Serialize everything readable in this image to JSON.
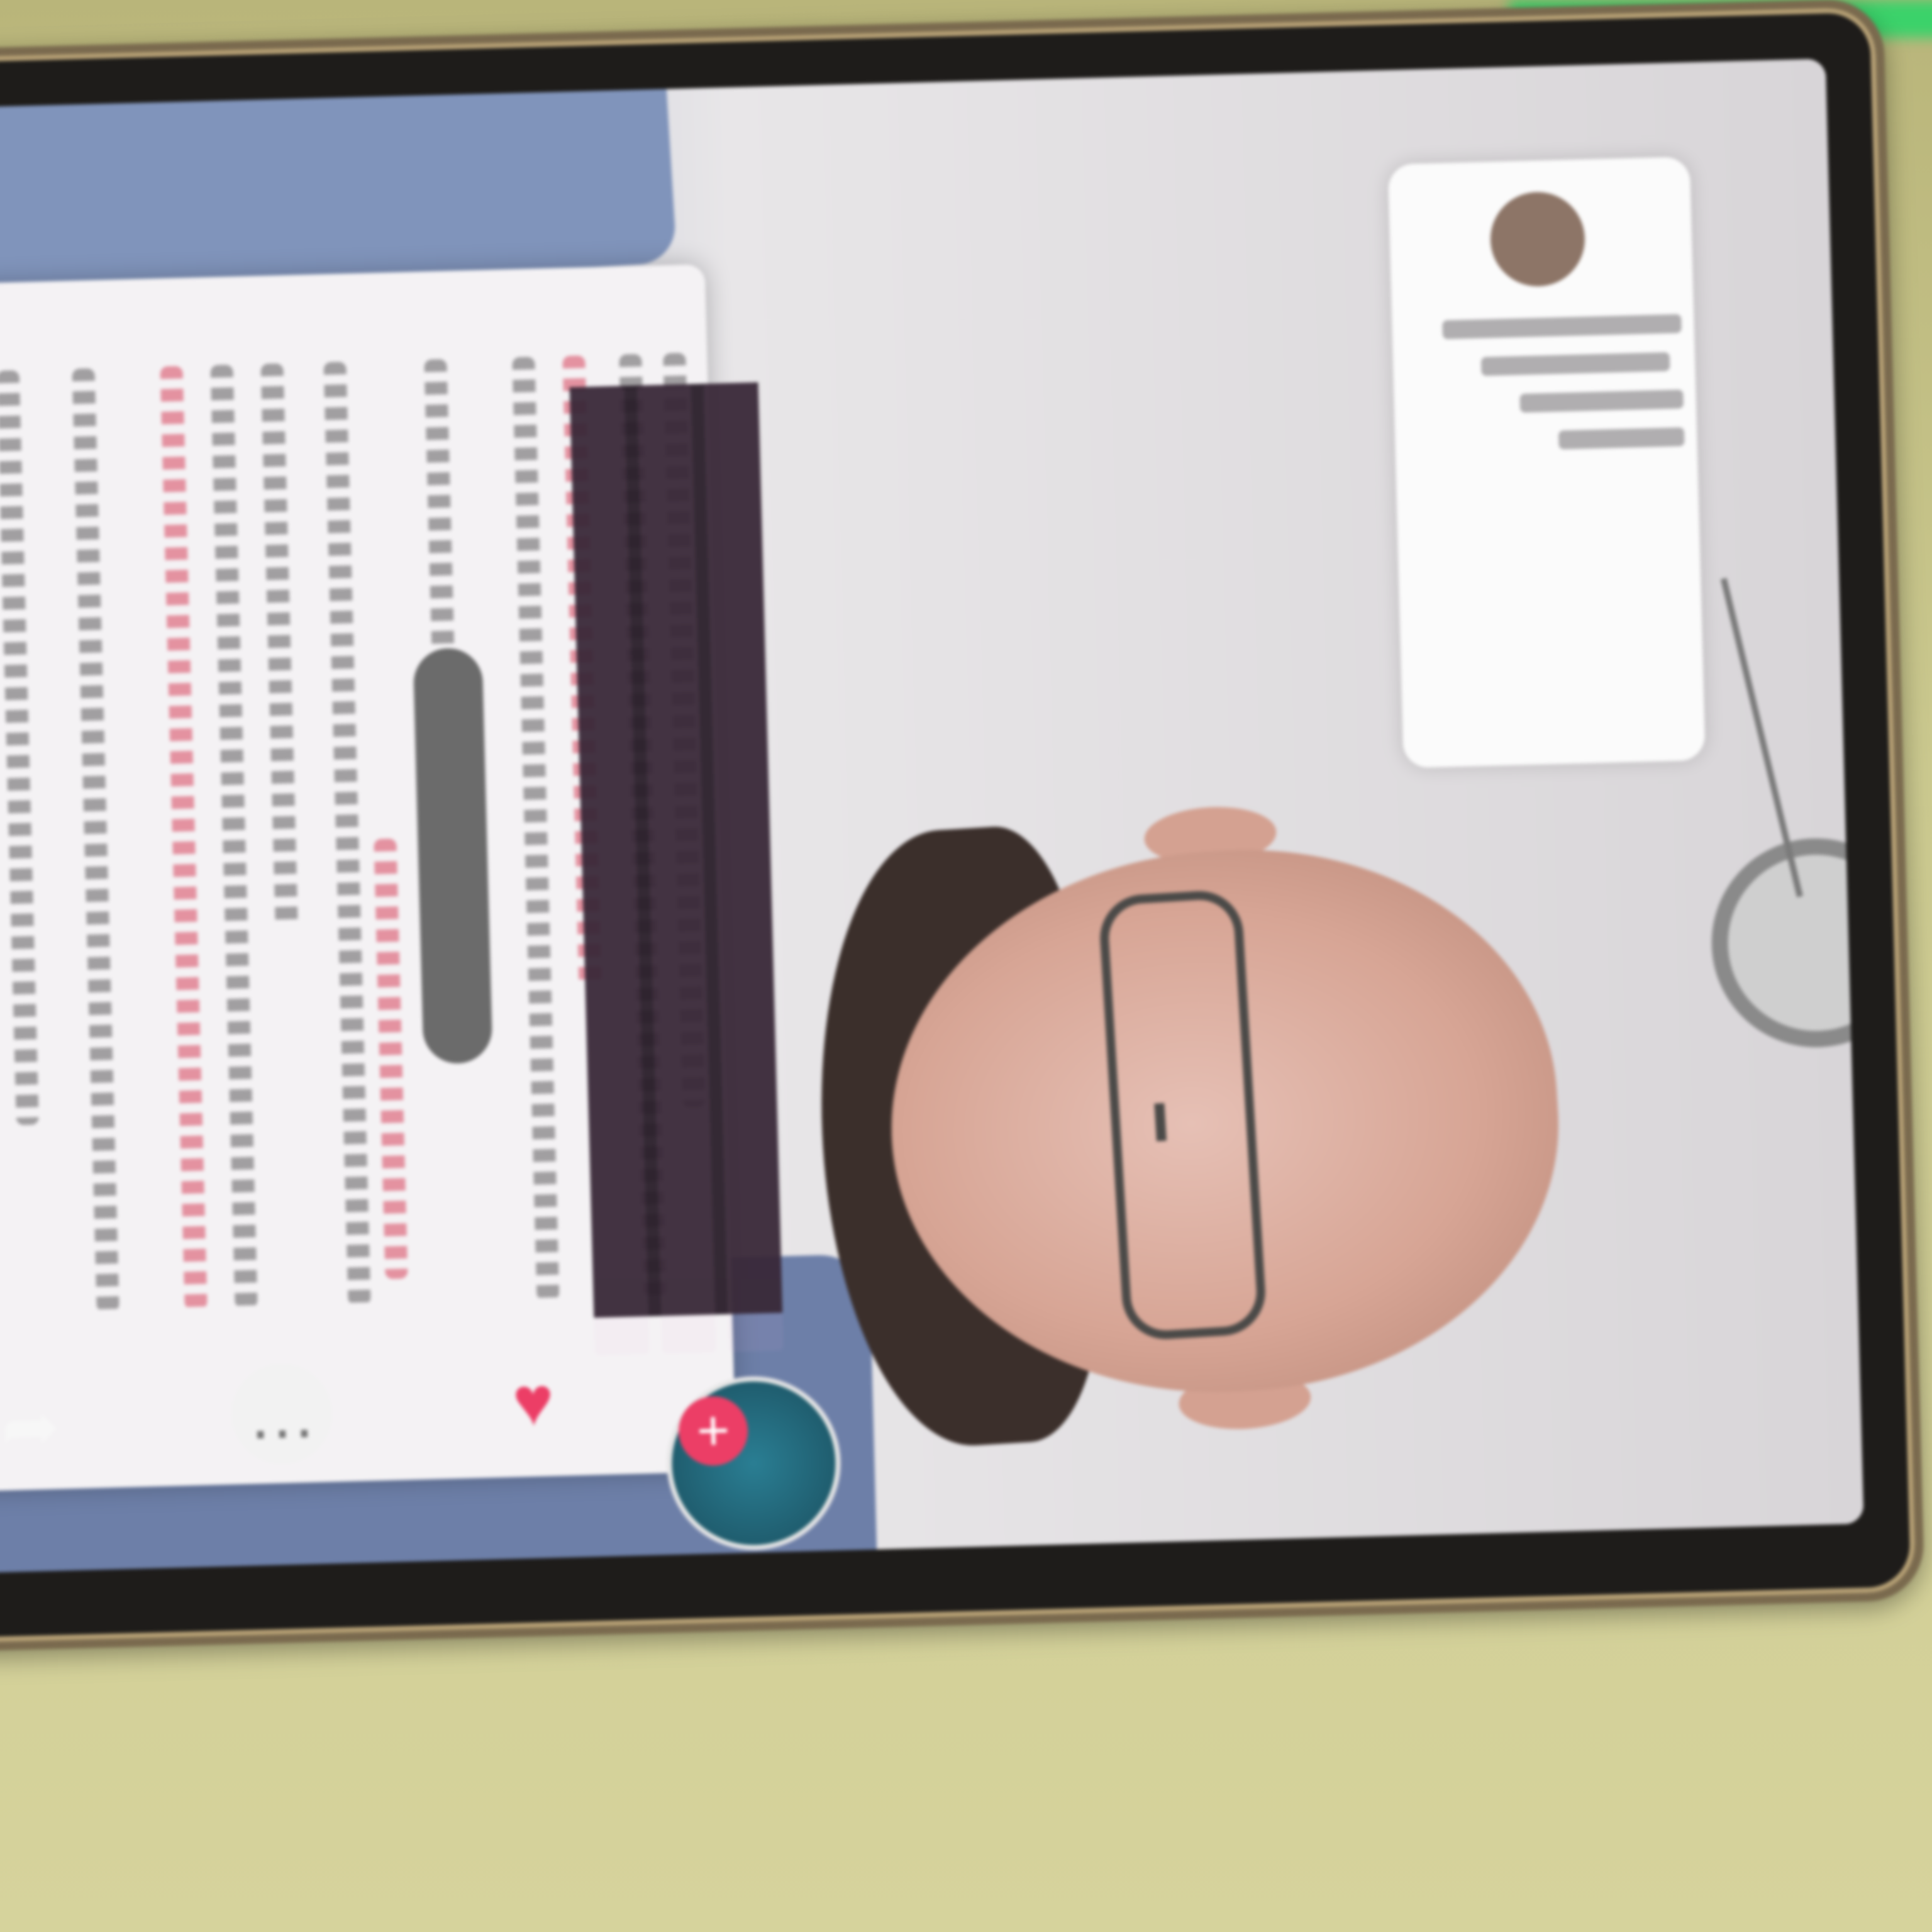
{
  "scene": {
    "kind": "photo of a phone screen showing a short-video app",
    "colors": {
      "table": "#c9c88e",
      "phone_frame": "#7a6a4e",
      "headline_pink": "#f3b4e7",
      "like_red": "#ec3e66",
      "scrubs_blue": "#8094bb"
    }
  },
  "video": {
    "headline_lines": [
      "",
      "",
      ""
    ],
    "article_badge": "",
    "caption_text": ""
  },
  "actions": {
    "avatar_icon": "creator-avatar",
    "follow_icon": "plus-icon",
    "like_icon": "heart-icon",
    "like_count": "",
    "comment_icon": "comment-bubble-icon",
    "comment_count": "",
    "share_icon": "share-arrow-icon",
    "share_count": ""
  }
}
